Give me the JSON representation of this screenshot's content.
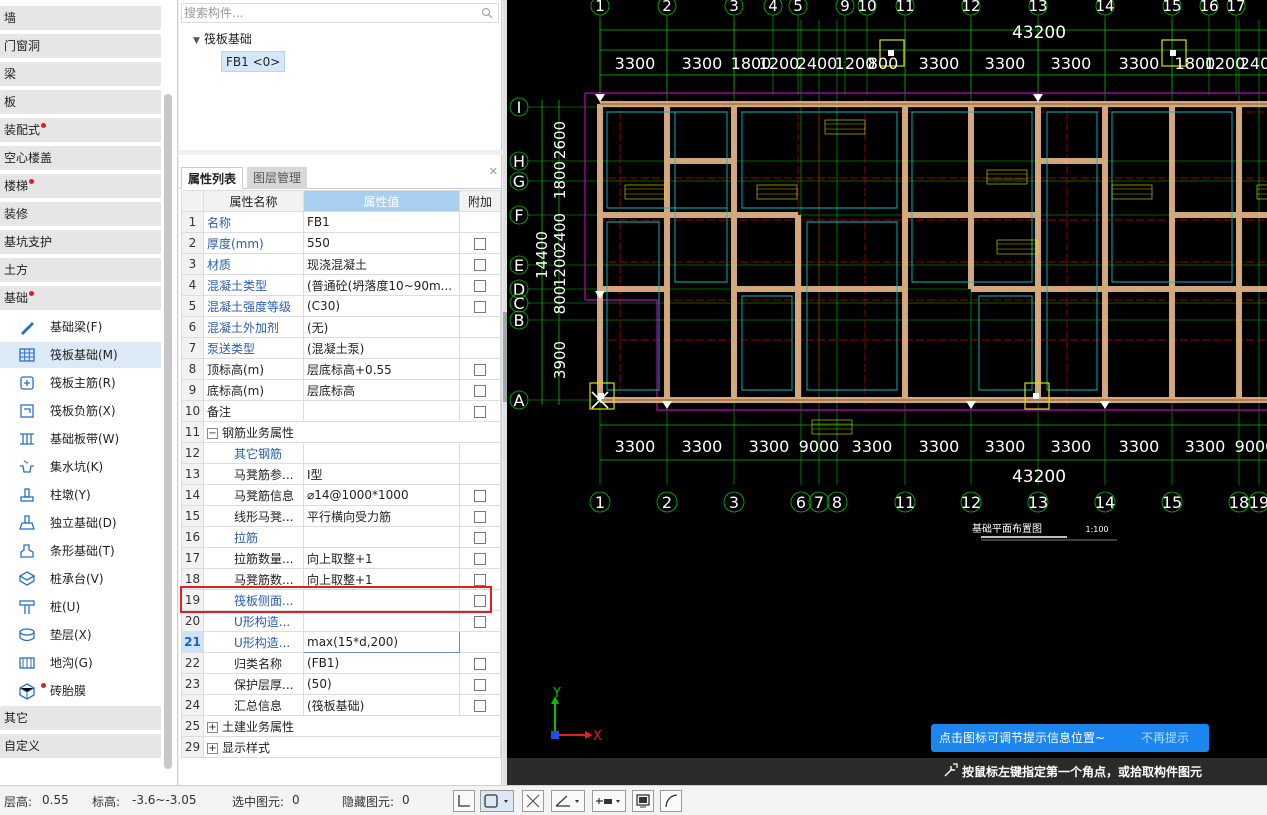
{
  "sidebar": {
    "categories_top": [
      {
        "label": "墙",
        "dot": false
      },
      {
        "label": "门窗洞",
        "dot": false
      },
      {
        "label": "梁",
        "dot": false
      },
      {
        "label": "板",
        "dot": false
      },
      {
        "label": "装配式",
        "dot": true
      },
      {
        "label": "空心楼盖",
        "dot": false
      },
      {
        "label": "楼梯",
        "dot": true
      },
      {
        "label": "装修",
        "dot": false
      },
      {
        "label": "基坑支护",
        "dot": false
      },
      {
        "label": "土方",
        "dot": false
      },
      {
        "label": "基础",
        "dot": true
      }
    ],
    "items": [
      {
        "label": "基础梁(F)",
        "icon": "beam-pencil-icon"
      },
      {
        "label": "筏板基础(M)",
        "icon": "raft-grid-icon",
        "active": true
      },
      {
        "label": "筏板主筋(R)",
        "icon": "raft-main-rebar-icon"
      },
      {
        "label": "筏板负筋(X)",
        "icon": "raft-neg-rebar-icon"
      },
      {
        "label": "基础板带(W)",
        "icon": "slab-strip-icon"
      },
      {
        "label": "集水坑(K)",
        "icon": "sump-pit-icon"
      },
      {
        "label": "柱墩(Y)",
        "icon": "column-pier-icon"
      },
      {
        "label": "独立基础(D)",
        "icon": "isolated-footing-icon"
      },
      {
        "label": "条形基础(T)",
        "icon": "strip-footing-icon"
      },
      {
        "label": "桩承台(V)",
        "icon": "pile-cap-icon"
      },
      {
        "label": "桩(U)",
        "icon": "pile-icon"
      },
      {
        "label": "垫层(X)",
        "icon": "cushion-layer-icon"
      },
      {
        "label": "地沟(G)",
        "icon": "trench-icon"
      },
      {
        "label": "砖胎膜",
        "icon": "brick-mold-icon",
        "dot": true
      }
    ],
    "categories_bottom": [
      {
        "label": "其它"
      },
      {
        "label": "自定义"
      }
    ]
  },
  "tree": {
    "search_placeholder": "搜索构件...",
    "node": "筏板基础",
    "leaf": "FB1 <0>"
  },
  "properties": {
    "tabs": [
      "属性列表",
      "图层管理"
    ],
    "headers": {
      "name": "属性名称",
      "value": "属性值",
      "extra": "附加"
    },
    "rows": [
      {
        "n": "1",
        "name": "名称",
        "value": "FB1",
        "link": true,
        "chk": false
      },
      {
        "n": "2",
        "name": "厚度(mm)",
        "value": "550",
        "link": true,
        "chk": true
      },
      {
        "n": "3",
        "name": "材质",
        "value": "现浇混凝土",
        "link": true,
        "chk": true
      },
      {
        "n": "4",
        "name": "混凝土类型",
        "value": "(普通砼(坍落度10~90m...",
        "link": true,
        "chk": true
      },
      {
        "n": "5",
        "name": "混凝土强度等级",
        "value": "(C30)",
        "link": true,
        "chk": true
      },
      {
        "n": "6",
        "name": "混凝土外加剂",
        "value": "(无)",
        "link": true,
        "chk": false
      },
      {
        "n": "7",
        "name": "泵送类型",
        "value": "(混凝土泵)",
        "link": true,
        "chk": false
      },
      {
        "n": "8",
        "name": "顶标高(m)",
        "value": "层底标高+0.55",
        "link": false,
        "chk": true
      },
      {
        "n": "9",
        "name": "底标高(m)",
        "value": "层底标高",
        "link": false,
        "chk": true
      },
      {
        "n": "10",
        "name": "备注",
        "value": "",
        "link": false,
        "chk": true
      },
      {
        "n": "11",
        "name": "钢筋业务属性",
        "value": "",
        "group": "−",
        "chk": false
      },
      {
        "n": "12",
        "name": "其它钢筋",
        "value": "",
        "link": true,
        "ind": true,
        "chk": false
      },
      {
        "n": "13",
        "name": "马凳筋参...",
        "value": "Ⅰ型",
        "link": false,
        "ind": true,
        "chk": false
      },
      {
        "n": "14",
        "name": "马凳筋信息",
        "value": "⌀14@1000*1000",
        "link": false,
        "ind": true,
        "chk": true
      },
      {
        "n": "15",
        "name": "线形马凳...",
        "value": "平行横向受力筋",
        "link": false,
        "ind": true,
        "chk": true
      },
      {
        "n": "16",
        "name": "拉筋",
        "value": "",
        "link": true,
        "ind": true,
        "chk": true
      },
      {
        "n": "17",
        "name": "拉筋数量...",
        "value": "向上取整+1",
        "link": false,
        "ind": true,
        "chk": true
      },
      {
        "n": "18",
        "name": "马凳筋数...",
        "value": "向上取整+1",
        "link": false,
        "ind": true,
        "chk": true
      },
      {
        "n": "19",
        "name": "筏板侧面...",
        "value": "",
        "link": true,
        "ind": true,
        "chk": true
      },
      {
        "n": "20",
        "name": "U形构造...",
        "value": "",
        "link": true,
        "ind": true,
        "chk": true
      },
      {
        "n": "21",
        "name": "U形构造...",
        "value": "max(15*d,200)",
        "link": true,
        "ind": true,
        "chk": false,
        "sel": true
      },
      {
        "n": "22",
        "name": "归类名称",
        "value": "(FB1)",
        "link": false,
        "ind": true,
        "chk": true
      },
      {
        "n": "23",
        "name": "保护层厚...",
        "value": "(50)",
        "link": false,
        "ind": true,
        "chk": true
      },
      {
        "n": "24",
        "name": "汇总信息",
        "value": "(筏板基础)",
        "link": false,
        "ind": true,
        "chk": true
      },
      {
        "n": "25",
        "name": "土建业务属性",
        "value": "",
        "group": "+",
        "chk": false
      },
      {
        "n": "29",
        "name": "显示样式",
        "value": "",
        "group": "+",
        "chk": false
      }
    ]
  },
  "cad": {
    "top_axes": [
      "1",
      "2",
      "3",
      "4",
      "5",
      "9",
      "10",
      "11",
      "12",
      "13",
      "14",
      "15",
      "16",
      "17"
    ],
    "bottom_axes": [
      "1",
      "2",
      "3",
      "6",
      "7",
      "8",
      "11",
      "12",
      "13",
      "14",
      "15",
      "18",
      "19"
    ],
    "left_axes": [
      "I",
      "H",
      "G",
      "F",
      "E",
      "D",
      "C",
      "B",
      "A"
    ],
    "total_dim": "43200",
    "top_dims": [
      "3300",
      "3300",
      "1800",
      "1200",
      "2400",
      "1200",
      "800",
      "3300",
      "3300",
      "3300",
      "3300",
      "1800",
      "1200",
      "240"
    ],
    "bottom_dims": [
      "3300",
      "3300",
      "3300",
      "9000",
      "3300",
      "3300",
      "3300",
      "3300",
      "3300",
      "3300",
      "9000"
    ],
    "left_dims": [
      "2600",
      "1800",
      "2400",
      "1200",
      "800",
      "3900"
    ],
    "left_total": "14400",
    "drawing_title": "基础平面布置图",
    "scale": "1:100",
    "axis_y": "Y",
    "axis_x": "X",
    "tip": "点击图标可调节提示信息位置~",
    "tip_dismiss": "不再提示",
    "command": "按鼠标左键指定第一个角点，或拾取构件图元",
    "colors": {
      "grid": "#00c000",
      "wall": "#e8b88a",
      "purple": "#c000c0",
      "cyan": "#00c0c0",
      "yellow": "#e0e000",
      "red": "#d00000",
      "white": "#ffffff"
    }
  },
  "status": {
    "floor_height_label": "层高:",
    "floor_height": "0.55",
    "elev_label": "标高:",
    "elev": "-3.6~-3.05",
    "selected_label": "选中图元:",
    "selected": "0",
    "hidden_label": "隐藏图元:",
    "hidden": "0"
  }
}
